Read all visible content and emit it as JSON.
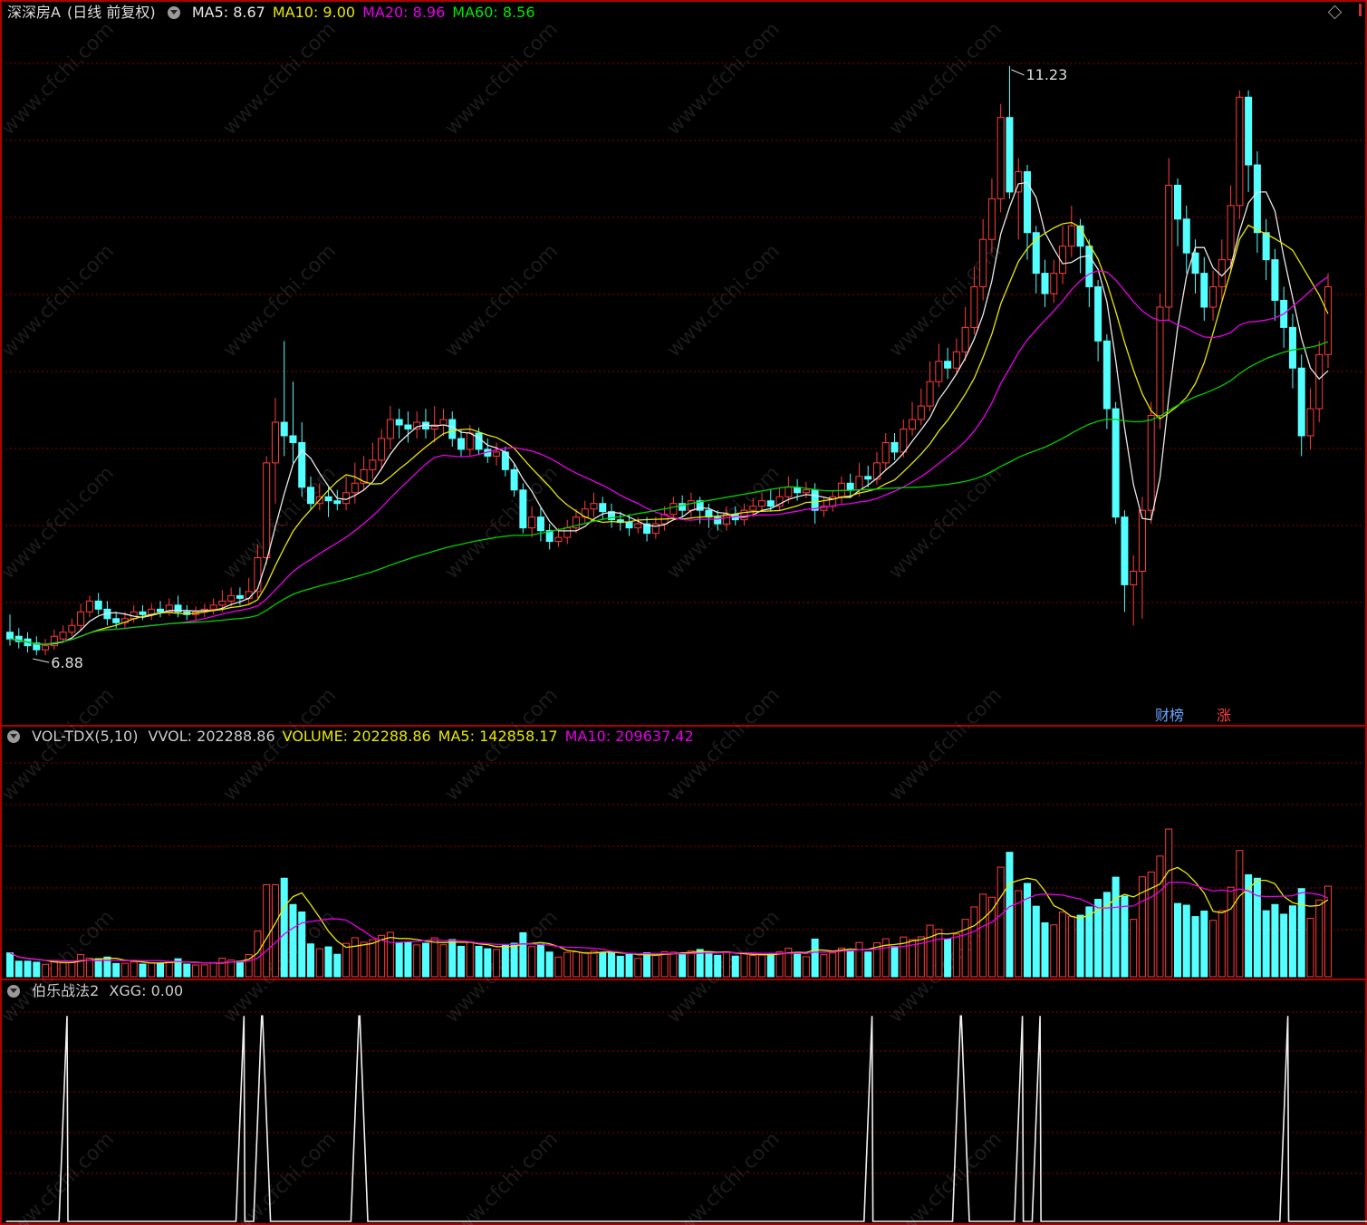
{
  "main_panel": {
    "stock_name": "深深房A",
    "period": "(日线 前复权)",
    "indicators": [
      {
        "label": "MA5: 8.67",
        "color": "#e8e8e8"
      },
      {
        "label": "MA10: 9.00",
        "color": "#e8e800"
      },
      {
        "label": "MA20: 8.96",
        "color": "#e800e8"
      },
      {
        "label": "MA60: 8.56",
        "color": "#00e800"
      }
    ],
    "high_label": "11.23",
    "low_label": "6.88",
    "badges": [
      {
        "label": "财榜",
        "color": "#6aa7ff"
      },
      {
        "label": "涨",
        "color": "#ff4040"
      }
    ]
  },
  "volume_panel": {
    "name": "VOL-TDX(5,10)",
    "values": [
      {
        "label": "VVOL: 202288.86",
        "color": "#cccccc"
      },
      {
        "label": "VOLUME: 202288.86",
        "color": "#e8e800"
      },
      {
        "label": "MA5: 142858.17",
        "color": "#e8e800"
      },
      {
        "label": "MA10: 209637.42",
        "color": "#e800e8"
      }
    ]
  },
  "signal_panel": {
    "name": "伯乐战法2",
    "values": [
      {
        "label": "XGG: 0.00",
        "color": "#cccccc"
      }
    ]
  },
  "watermark": "www.cfchi.com",
  "colors": {
    "up": "#ff3c3c",
    "down": "#54ffff",
    "grid": "#8b0000",
    "panel_border": "#b00000"
  },
  "chart_data": {
    "type": "candlestick",
    "y_range": [
      6.6,
      11.45
    ],
    "candles": [
      [
        7.05,
        7.0,
        7.18,
        6.95
      ],
      [
        7.02,
        6.98,
        7.08,
        6.93
      ],
      [
        7.0,
        6.95,
        7.05,
        6.9
      ],
      [
        6.97,
        6.92,
        7.02,
        6.88
      ],
      [
        6.92,
        6.95,
        7.0,
        6.88
      ],
      [
        6.95,
        7.02,
        7.07,
        6.92
      ],
      [
        7.0,
        7.05,
        7.1,
        6.97
      ],
      [
        7.05,
        7.1,
        7.15,
        7.02
      ],
      [
        7.1,
        7.2,
        7.26,
        7.06
      ],
      [
        7.2,
        7.28,
        7.32,
        7.16
      ],
      [
        7.28,
        7.22,
        7.34,
        7.18
      ],
      [
        7.22,
        7.15,
        7.28,
        7.1
      ],
      [
        7.15,
        7.12,
        7.2,
        7.08
      ],
      [
        7.12,
        7.15,
        7.2,
        7.08
      ],
      [
        7.15,
        7.2,
        7.25,
        7.12
      ],
      [
        7.2,
        7.18,
        7.25,
        7.14
      ],
      [
        7.18,
        7.22,
        7.26,
        7.14
      ],
      [
        7.22,
        7.2,
        7.28,
        7.16
      ],
      [
        7.2,
        7.25,
        7.3,
        7.17
      ],
      [
        7.25,
        7.2,
        7.32,
        7.16
      ],
      [
        7.2,
        7.18,
        7.25,
        7.14
      ],
      [
        7.18,
        7.2,
        7.24,
        7.14
      ],
      [
        7.2,
        7.22,
        7.26,
        7.16
      ],
      [
        7.22,
        7.25,
        7.3,
        7.18
      ],
      [
        7.25,
        7.28,
        7.36,
        7.2
      ],
      [
        7.28,
        7.32,
        7.38,
        7.24
      ],
      [
        7.32,
        7.3,
        7.38,
        7.25
      ],
      [
        7.3,
        7.35,
        7.45,
        7.26
      ],
      [
        7.35,
        7.6,
        7.7,
        7.3
      ],
      [
        7.6,
        8.3,
        8.35,
        7.55
      ],
      [
        8.3,
        8.6,
        8.78,
        8.0
      ],
      [
        8.6,
        8.5,
        9.2,
        8.35
      ],
      [
        8.5,
        8.45,
        8.9,
        8.3
      ],
      [
        8.45,
        8.12,
        8.6,
        8.05
      ],
      [
        8.12,
        8.0,
        8.2,
        7.95
      ],
      [
        8.0,
        8.05,
        8.15,
        7.95
      ],
      [
        8.05,
        8.02,
        8.12,
        7.9
      ],
      [
        8.02,
        8.0,
        8.1,
        7.95
      ],
      [
        8.0,
        8.08,
        8.2,
        7.95
      ],
      [
        8.08,
        8.15,
        8.3,
        8.0
      ],
      [
        8.15,
        8.25,
        8.35,
        8.1
      ],
      [
        8.25,
        8.32,
        8.45,
        8.18
      ],
      [
        8.32,
        8.48,
        8.55,
        8.25
      ],
      [
        8.48,
        8.62,
        8.72,
        8.4
      ],
      [
        8.62,
        8.58,
        8.7,
        8.48
      ],
      [
        8.58,
        8.55,
        8.68,
        8.45
      ],
      [
        8.55,
        8.6,
        8.68,
        8.48
      ],
      [
        8.6,
        8.55,
        8.7,
        8.48
      ],
      [
        8.55,
        8.58,
        8.72,
        8.45
      ],
      [
        8.58,
        8.62,
        8.7,
        8.5
      ],
      [
        8.62,
        8.48,
        8.68,
        8.42
      ],
      [
        8.48,
        8.4,
        8.55,
        8.35
      ],
      [
        8.4,
        8.52,
        8.58,
        8.35
      ],
      [
        8.52,
        8.4,
        8.56,
        8.36
      ],
      [
        8.4,
        8.35,
        8.48,
        8.3
      ],
      [
        8.35,
        8.38,
        8.45,
        8.28
      ],
      [
        8.38,
        8.25,
        8.42,
        8.2
      ],
      [
        8.25,
        8.1,
        8.3,
        8.05
      ],
      [
        8.1,
        7.82,
        8.15,
        7.78
      ],
      [
        7.82,
        7.9,
        7.98,
        7.75
      ],
      [
        7.9,
        7.8,
        7.98,
        7.72
      ],
      [
        7.8,
        7.72,
        7.85,
        7.66
      ],
      [
        7.72,
        7.75,
        7.82,
        7.68
      ],
      [
        7.75,
        7.82,
        7.88,
        7.7
      ],
      [
        7.82,
        7.9,
        7.96,
        7.78
      ],
      [
        7.9,
        7.96,
        8.02,
        7.85
      ],
      [
        7.96,
        8.0,
        8.08,
        7.9
      ],
      [
        8.0,
        7.94,
        8.05,
        7.88
      ],
      [
        7.94,
        7.88,
        8.0,
        7.82
      ],
      [
        7.88,
        7.86,
        7.94,
        7.8
      ],
      [
        7.86,
        7.82,
        7.92,
        7.76
      ],
      [
        7.82,
        7.85,
        7.9,
        7.78
      ],
      [
        7.85,
        7.78,
        7.9,
        7.72
      ],
      [
        7.78,
        7.85,
        7.9,
        7.74
      ],
      [
        7.85,
        7.92,
        7.98,
        7.8
      ],
      [
        7.92,
        8.0,
        8.05,
        7.88
      ],
      [
        8.0,
        7.95,
        8.06,
        7.9
      ],
      [
        7.95,
        8.02,
        8.08,
        7.9
      ],
      [
        8.02,
        7.95,
        8.05,
        7.85
      ],
      [
        7.95,
        7.9,
        8.0,
        7.82
      ],
      [
        7.9,
        7.85,
        7.95,
        7.8
      ],
      [
        7.85,
        7.92,
        7.98,
        7.8
      ],
      [
        7.92,
        7.88,
        7.98,
        7.84
      ],
      [
        7.88,
        7.95,
        8.0,
        7.84
      ],
      [
        7.95,
        7.98,
        8.04,
        7.9
      ],
      [
        7.98,
        8.02,
        8.08,
        7.94
      ],
      [
        8.02,
        7.98,
        8.1,
        7.94
      ],
      [
        7.98,
        8.05,
        8.12,
        7.95
      ],
      [
        8.05,
        8.12,
        8.2,
        8.0
      ],
      [
        8.12,
        8.08,
        8.18,
        8.02
      ],
      [
        8.08,
        8.1,
        8.16,
        8.04
      ],
      [
        8.1,
        7.95,
        8.15,
        7.85
      ],
      [
        7.95,
        7.98,
        8.05,
        7.9
      ],
      [
        7.98,
        8.05,
        8.1,
        7.94
      ],
      [
        8.05,
        8.15,
        8.2,
        8.0
      ],
      [
        8.15,
        8.1,
        8.22,
        8.04
      ],
      [
        8.1,
        8.2,
        8.3,
        8.05
      ],
      [
        8.2,
        8.18,
        8.28,
        8.12
      ],
      [
        8.18,
        8.3,
        8.38,
        8.14
      ],
      [
        8.3,
        8.45,
        8.52,
        8.25
      ],
      [
        8.45,
        8.38,
        8.52,
        8.32
      ],
      [
        8.38,
        8.55,
        8.62,
        8.34
      ],
      [
        8.55,
        8.62,
        8.75,
        8.5
      ],
      [
        8.62,
        8.72,
        8.85,
        8.58
      ],
      [
        8.72,
        8.9,
        9.05,
        8.68
      ],
      [
        8.9,
        9.05,
        9.18,
        8.86
      ],
      [
        9.05,
        9.0,
        9.15,
        8.92
      ],
      [
        9.0,
        9.12,
        9.22,
        8.95
      ],
      [
        9.12,
        9.3,
        9.45,
        9.05
      ],
      [
        9.3,
        9.6,
        9.75,
        9.25
      ],
      [
        9.6,
        9.95,
        10.1,
        9.5
      ],
      [
        9.95,
        10.25,
        10.4,
        9.85
      ],
      [
        10.25,
        10.85,
        10.95,
        10.15
      ],
      [
        10.85,
        10.3,
        11.23,
        10.25
      ],
      [
        10.3,
        10.45,
        10.55,
        9.95
      ],
      [
        10.45,
        10.0,
        10.5,
        9.8
      ],
      [
        10.0,
        9.7,
        10.05,
        9.55
      ],
      [
        9.7,
        9.55,
        9.8,
        9.45
      ],
      [
        9.55,
        9.7,
        9.8,
        9.48
      ],
      [
        9.7,
        9.9,
        10.05,
        9.62
      ],
      [
        9.9,
        10.05,
        10.2,
        9.82
      ],
      [
        10.05,
        9.9,
        10.1,
        9.7
      ],
      [
        9.9,
        9.6,
        9.95,
        9.45
      ],
      [
        9.6,
        9.2,
        9.65,
        9.05
      ],
      [
        9.2,
        8.7,
        9.25,
        8.55
      ],
      [
        8.7,
        7.9,
        8.75,
        7.85
      ],
      [
        7.9,
        7.4,
        7.95,
        7.2
      ],
      [
        7.4,
        7.5,
        7.62,
        7.1
      ],
      [
        7.5,
        7.95,
        8.05,
        7.15
      ],
      [
        7.95,
        8.65,
        8.75,
        7.85
      ],
      [
        8.65,
        9.45,
        9.55,
        8.55
      ],
      [
        9.45,
        10.35,
        10.55,
        9.35
      ],
      [
        10.35,
        10.1,
        10.4,
        9.9
      ],
      [
        10.1,
        9.85,
        10.2,
        9.7
      ],
      [
        9.85,
        9.7,
        9.95,
        9.55
      ],
      [
        9.7,
        9.45,
        9.82,
        9.35
      ],
      [
        9.45,
        9.6,
        9.72,
        9.35
      ],
      [
        9.6,
        9.8,
        9.95,
        9.5
      ],
      [
        9.8,
        10.2,
        10.35,
        9.7
      ],
      [
        10.2,
        11.0,
        11.05,
        10.1
      ],
      [
        11.0,
        10.5,
        11.05,
        10.3
      ],
      [
        10.5,
        10.0,
        10.6,
        9.85
      ],
      [
        10.0,
        9.8,
        10.1,
        9.65
      ],
      [
        9.8,
        9.5,
        9.88,
        9.35
      ],
      [
        9.5,
        9.3,
        9.6,
        9.15
      ],
      [
        9.3,
        9.0,
        9.4,
        8.85
      ],
      [
        9.0,
        8.5,
        9.1,
        8.35
      ],
      [
        8.5,
        8.7,
        8.85,
        8.4
      ],
      [
        8.7,
        9.1,
        9.2,
        8.6
      ],
      [
        9.1,
        9.6,
        9.7,
        9.0
      ]
    ],
    "volume_y_range": [
      0,
      260000
    ],
    "signal_y_range": [
      0,
      1.05
    ],
    "signals": [
      [
        0,
        0
      ],
      [
        0,
        0
      ],
      [
        0,
        0
      ],
      [
        0,
        0
      ],
      [
        0,
        0
      ],
      [
        0,
        0
      ],
      [
        0,
        1
      ],
      [
        0,
        0
      ],
      [
        0,
        0
      ],
      [
        0,
        0
      ],
      [
        0,
        0
      ],
      [
        0,
        0
      ],
      [
        0,
        0
      ],
      [
        0,
        0
      ],
      [
        0,
        0
      ],
      [
        0,
        0
      ],
      [
        0,
        0
      ],
      [
        0,
        0
      ],
      [
        0,
        0
      ],
      [
        0,
        0
      ],
      [
        0,
        0
      ],
      [
        0,
        0
      ],
      [
        0,
        0
      ],
      [
        0,
        0
      ],
      [
        0,
        0
      ],
      [
        0,
        0
      ],
      [
        0,
        1
      ],
      [
        0,
        0
      ],
      [
        0,
        1
      ],
      [
        1,
        0
      ],
      [
        0,
        0
      ],
      [
        0,
        0
      ],
      [
        0,
        0
      ],
      [
        0,
        0
      ],
      [
        0,
        0
      ],
      [
        0,
        0
      ],
      [
        0,
        0
      ],
      [
        0,
        0
      ],
      [
        0,
        0
      ],
      [
        0,
        1
      ],
      [
        1,
        0
      ],
      [
        0,
        0
      ],
      [
        0,
        0
      ],
      [
        0,
        0
      ],
      [
        0,
        0
      ],
      [
        0,
        0
      ],
      [
        0,
        0
      ],
      [
        0,
        0
      ],
      [
        0,
        0
      ],
      [
        0,
        0
      ],
      [
        0,
        0
      ],
      [
        0,
        0
      ],
      [
        0,
        0
      ],
      [
        0,
        0
      ],
      [
        0,
        0
      ],
      [
        0,
        0
      ],
      [
        0,
        0
      ],
      [
        0,
        0
      ],
      [
        0,
        0
      ],
      [
        0,
        0
      ],
      [
        0,
        0
      ],
      [
        0,
        0
      ],
      [
        0,
        0
      ],
      [
        0,
        0
      ],
      [
        0,
        0
      ],
      [
        0,
        0
      ],
      [
        0,
        0
      ],
      [
        0,
        0
      ],
      [
        0,
        0
      ],
      [
        0,
        0
      ],
      [
        0,
        0
      ],
      [
        0,
        0
      ],
      [
        0,
        0
      ],
      [
        0,
        0
      ],
      [
        0,
        0
      ],
      [
        0,
        0
      ],
      [
        0,
        0
      ],
      [
        0,
        0
      ],
      [
        0,
        0
      ],
      [
        0,
        0
      ],
      [
        0,
        0
      ],
      [
        0,
        0
      ],
      [
        0,
        0
      ],
      [
        0,
        0
      ],
      [
        0,
        0
      ],
      [
        0,
        0
      ],
      [
        0,
        0
      ],
      [
        0,
        0
      ],
      [
        0,
        0
      ],
      [
        0,
        0
      ],
      [
        0,
        0
      ],
      [
        0,
        0
      ],
      [
        0,
        0
      ],
      [
        0,
        0
      ],
      [
        0,
        0
      ],
      [
        0,
        0
      ],
      [
        0,
        0
      ],
      [
        0,
        1
      ],
      [
        0,
        0
      ],
      [
        0,
        0
      ],
      [
        0,
        0
      ],
      [
        0,
        0
      ],
      [
        0,
        0
      ],
      [
        0,
        0
      ],
      [
        0,
        0
      ],
      [
        0,
        0
      ],
      [
        0,
        0
      ],
      [
        0,
        1
      ],
      [
        1,
        0
      ],
      [
        0,
        0
      ],
      [
        0,
        0
      ],
      [
        0,
        0
      ],
      [
        0,
        0
      ],
      [
        0,
        0
      ],
      [
        0,
        1
      ],
      [
        0,
        0
      ],
      [
        0,
        1
      ],
      [
        0,
        0
      ],
      [
        0,
        0
      ],
      [
        0,
        0
      ],
      [
        0,
        0
      ],
      [
        0,
        0
      ],
      [
        0,
        0
      ],
      [
        0,
        0
      ],
      [
        0,
        0
      ],
      [
        0,
        0
      ],
      [
        0,
        0
      ],
      [
        0,
        0
      ],
      [
        0,
        0
      ],
      [
        0,
        0
      ],
      [
        0,
        0
      ],
      [
        0,
        0
      ],
      [
        0,
        0
      ],
      [
        0,
        0
      ],
      [
        0,
        0
      ],
      [
        0,
        0
      ],
      [
        0,
        0
      ],
      [
        0,
        0
      ],
      [
        0,
        0
      ],
      [
        0,
        0
      ],
      [
        0,
        0
      ],
      [
        0,
        0
      ],
      [
        0,
        0
      ],
      [
        0,
        0
      ],
      [
        0,
        1
      ],
      [
        0,
        0
      ],
      [
        0,
        0
      ],
      [
        0,
        0
      ],
      [
        0,
        0
      ],
      [
        0,
        0
      ],
      [
        0,
        0
      ],
      [
        0,
        0
      ],
      [
        0,
        0
      ],
      [
        0,
        0
      ],
      [
        0,
        0
      ],
      [
        0,
        0
      ],
      [
        0,
        0
      ],
      [
        0,
        0
      ],
      [
        0,
        0
      ],
      [
        0,
        0
      ]
    ]
  }
}
